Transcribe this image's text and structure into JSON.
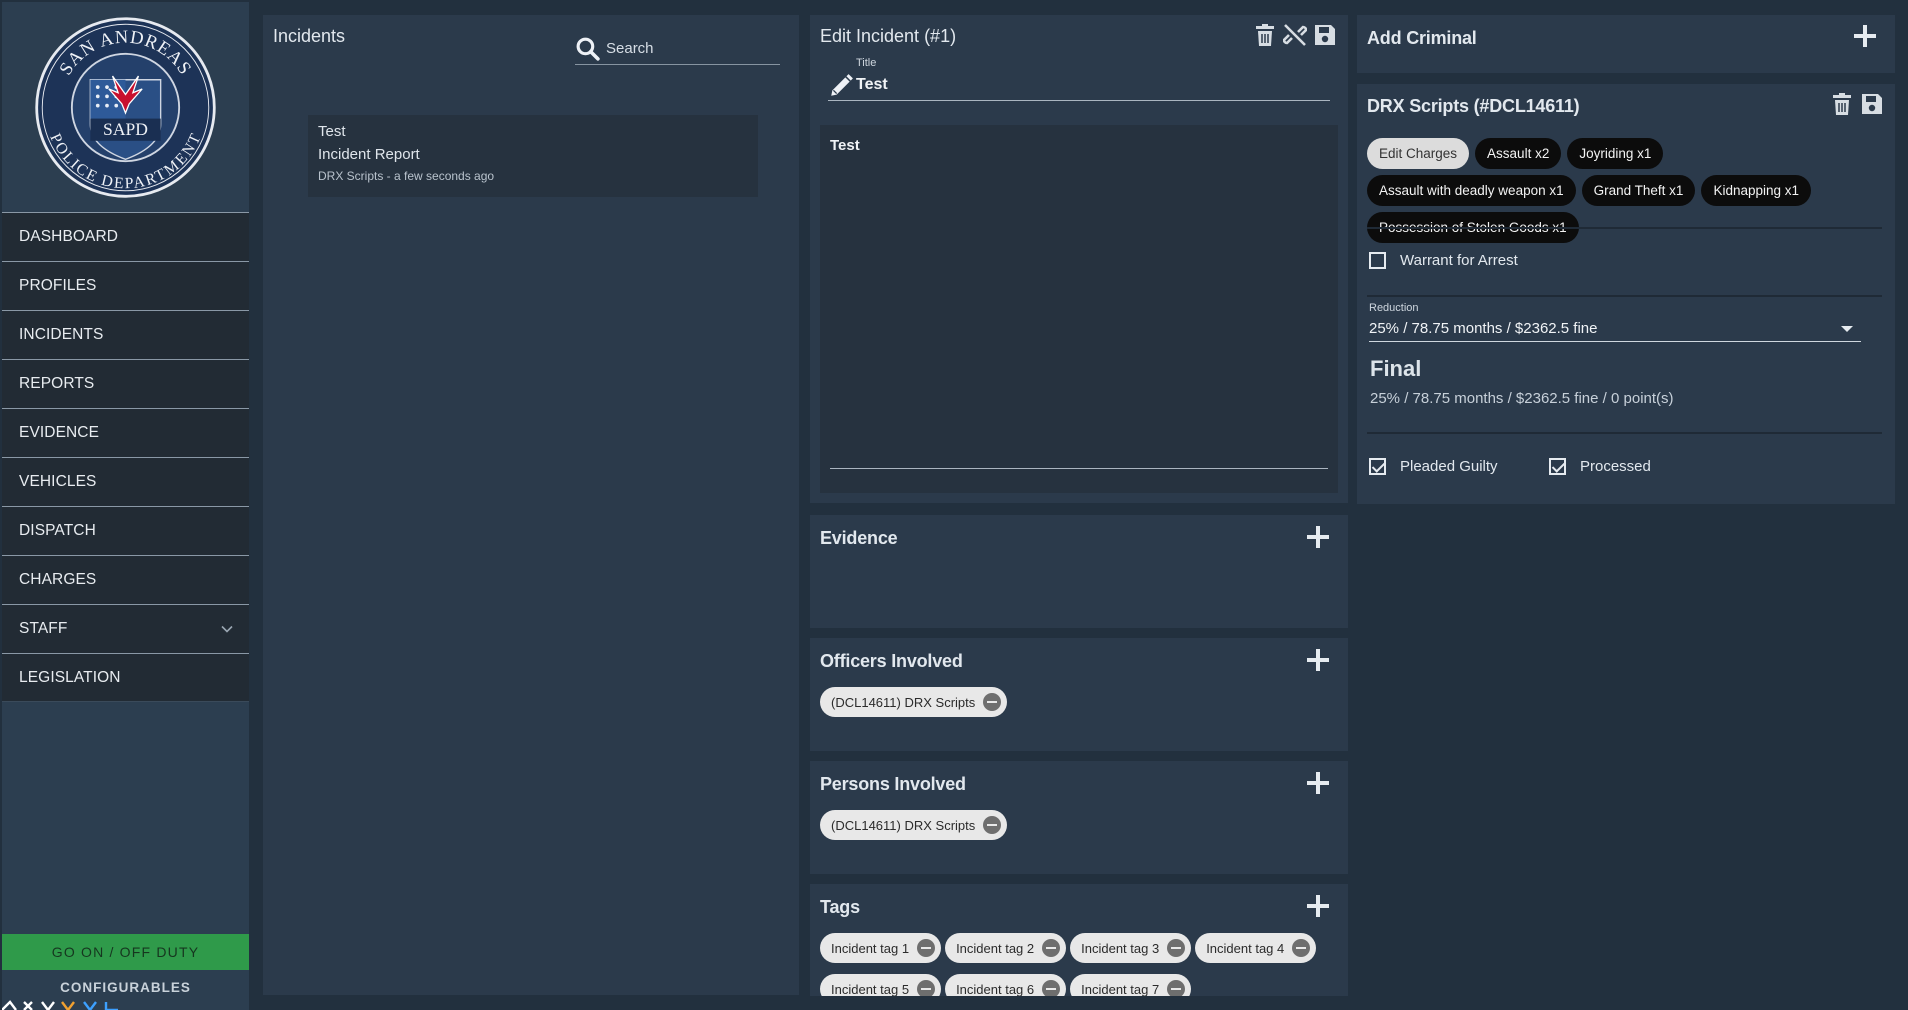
{
  "sidebar": {
    "logo": {
      "top_text": "SAN ANDREAS",
      "bottom_text": "POLICE DEPARTMENT",
      "center_text": "SAPD"
    },
    "items": [
      {
        "label": "DASHBOARD"
      },
      {
        "label": "PROFILES"
      },
      {
        "label": "INCIDENTS"
      },
      {
        "label": "REPORTS"
      },
      {
        "label": "EVIDENCE"
      },
      {
        "label": "VEHICLES"
      },
      {
        "label": "DISPATCH"
      },
      {
        "label": "CHARGES"
      },
      {
        "label": "STAFF",
        "icon": "chevron-down-icon"
      },
      {
        "label": "LEGISLATION"
      }
    ],
    "duty_button": "GO ON / OFF DUTY",
    "configurables_label": "CONFIGURABLES"
  },
  "incidents": {
    "title": "Incidents",
    "search": {
      "placeholder": "Search",
      "value": ""
    },
    "list": [
      {
        "title": "Test",
        "type": "Incident Report",
        "meta": "DRX Scripts - a few seconds ago"
      }
    ]
  },
  "edit_incident": {
    "title": "Edit Incident (#1)",
    "title_field": {
      "caption": "Title",
      "value": "Test"
    },
    "description": "Test",
    "icons": [
      "trash-icon",
      "unlink-icon",
      "save-icon"
    ]
  },
  "evidence": {
    "title": "Evidence"
  },
  "officers": {
    "title": "Officers Involved",
    "chips": [
      "(DCL14611) DRX Scripts"
    ]
  },
  "persons": {
    "title": "Persons Involved",
    "chips": [
      "(DCL14611) DRX Scripts"
    ]
  },
  "tags": {
    "title": "Tags",
    "chips": [
      "Incident tag 1",
      "Incident tag 2",
      "Incident tag 3",
      "Incident tag 4",
      "Incident tag 5",
      "Incident tag 6",
      "Incident tag 7"
    ]
  },
  "add_criminal": {
    "title": "Add Criminal"
  },
  "criminal": {
    "title": "DRX Scripts (#DCL14611)",
    "edit_charges_label": "Edit Charges",
    "charges": [
      "Assault x2",
      "Joyriding x1",
      "Assault with deadly weapon x1",
      "Grand Theft x1",
      "Kidnapping x1",
      "Possession of Stolen Goods x1"
    ],
    "warrant_label": "Warrant for Arrest",
    "warrant_checked": false,
    "reduction": {
      "caption": "Reduction",
      "value": "25% / 78.75 months / $2362.5 fine"
    },
    "final_title": "Final",
    "final_value": "25% / 78.75 months / $2362.5 fine / 0 point(s)",
    "pleaded_guilty_label": "Pleaded Guilty",
    "pleaded_guilty_checked": true,
    "processed_label": "Processed",
    "processed_checked": true
  },
  "colors": {
    "background": "#22303e",
    "panel": "#2b3a4b",
    "card": "#26323f",
    "duty_green": "#2f9a4a",
    "charge_pill": "#0c0c0c"
  }
}
